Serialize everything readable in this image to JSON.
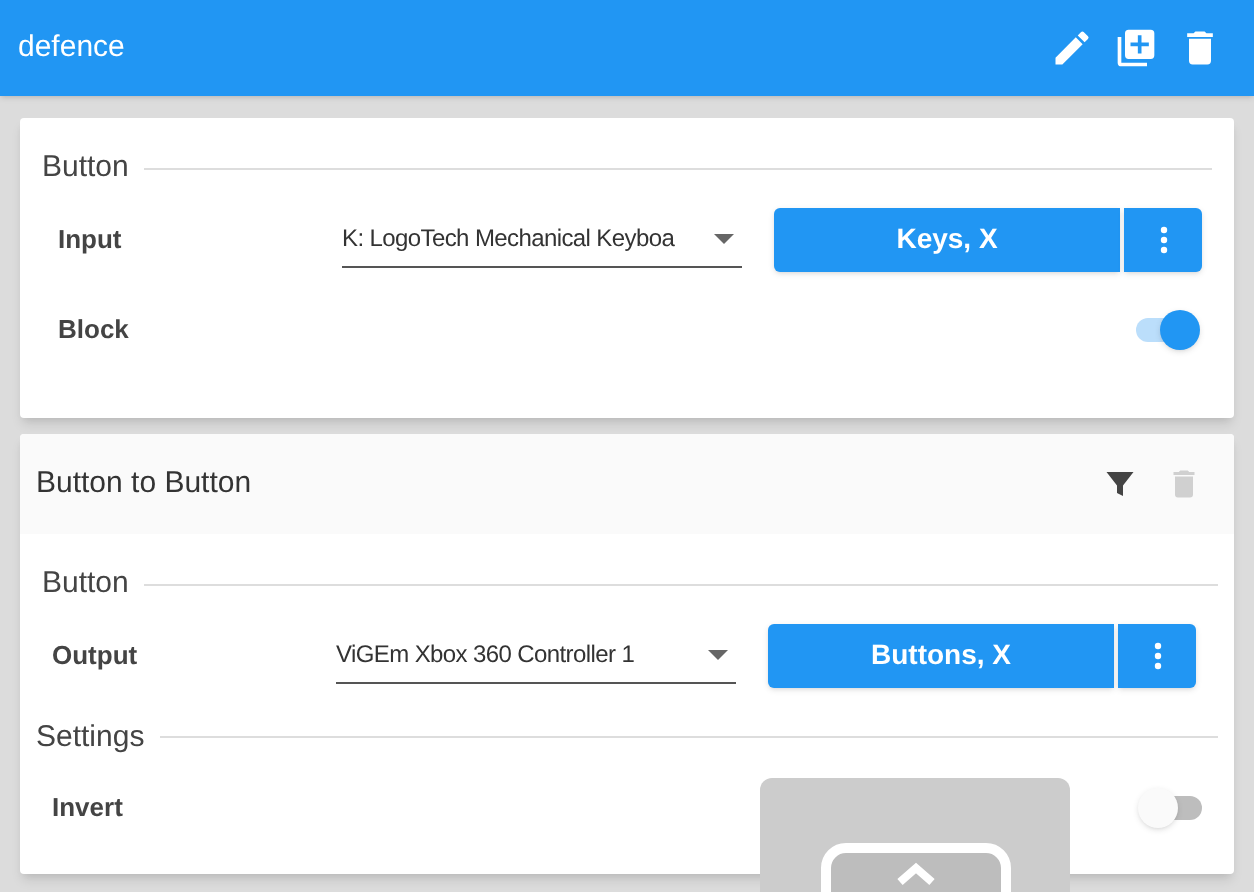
{
  "header": {
    "title": "defence"
  },
  "input_card": {
    "section": "Button",
    "device_row": {
      "label": "Input",
      "device": "K: LogoTech Mechanical Keyboa",
      "binding": "Keys, X"
    },
    "toggle_row": {
      "label": "Block",
      "on": true
    }
  },
  "mapping_card": {
    "title": "Button to Button",
    "delete_disabled": true,
    "section": "Button",
    "device_row": {
      "label": "Output",
      "device": "ViGEm Xbox 360 Controller 1",
      "binding": "Buttons, X"
    },
    "settings_section": "Settings",
    "toggle_row": {
      "label": "Invert",
      "on": false
    }
  }
}
